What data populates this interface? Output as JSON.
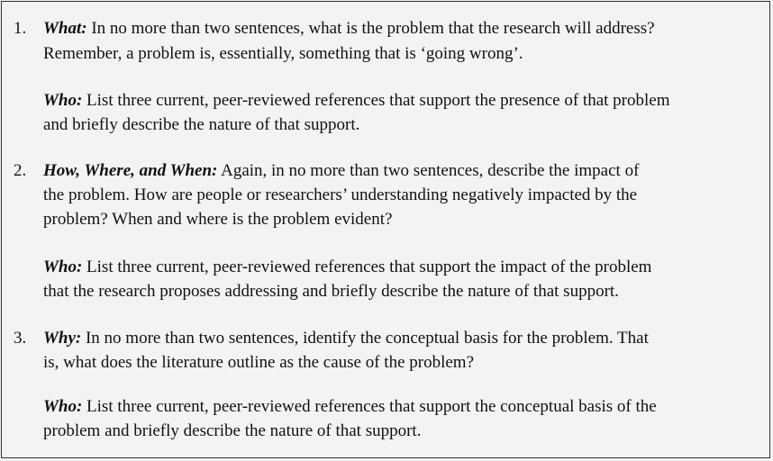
{
  "items": [
    {
      "number": "1.",
      "label": "What:",
      "lines": [
        " In no more than two sentences, what is the problem that the research will address?",
        "Remember, a problem is, essentially, something that is ‘going wrong’."
      ],
      "who_label": "Who:",
      "who_lines": [
        " List three current, peer-reviewed references that support the presence of that problem",
        "and briefly describe the nature of that support."
      ]
    },
    {
      "number": "2.",
      "label": "How, Where, and When:",
      "lines": [
        " Again, in no more than two sentences, describe the impact of",
        "the problem.  How are people or researchers’ understanding negatively impacted by the",
        "problem? When and where is the problem evident?"
      ],
      "who_label": "Who:",
      "who_lines": [
        " List three current, peer-reviewed references that support the impact of the problem",
        "that the research proposes addressing and briefly describe the nature of that support."
      ]
    },
    {
      "number": "3.",
      "label": "Why:",
      "lines": [
        " In no more than two sentences, identify the conceptual basis for the problem.  That",
        "is, what does the literature outline as the cause of the problem?"
      ],
      "who_label": "Who:",
      "who_lines": [
        " List three current, peer-reviewed references that support the conceptual basis of the",
        "problem and briefly describe the nature of that support."
      ]
    }
  ]
}
